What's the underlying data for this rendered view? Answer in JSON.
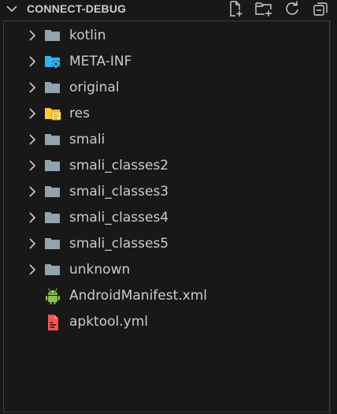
{
  "explorer": {
    "title": "CONNECT-DEBUG",
    "actions": [
      {
        "name": "new-file-icon"
      },
      {
        "name": "new-folder-icon"
      },
      {
        "name": "refresh-icon"
      },
      {
        "name": "collapse-all-icon"
      }
    ],
    "items": [
      {
        "label": "kotlin",
        "type": "folder",
        "icon": "folder-icon"
      },
      {
        "label": "META-INF",
        "type": "folder",
        "icon": "folder-config-icon"
      },
      {
        "label": "original",
        "type": "folder",
        "icon": "folder-icon"
      },
      {
        "label": "res",
        "type": "folder",
        "icon": "folder-resource-icon"
      },
      {
        "label": "smali",
        "type": "folder",
        "icon": "folder-icon"
      },
      {
        "label": "smali_classes2",
        "type": "folder",
        "icon": "folder-icon"
      },
      {
        "label": "smali_classes3",
        "type": "folder",
        "icon": "folder-icon"
      },
      {
        "label": "smali_classes4",
        "type": "folder",
        "icon": "folder-icon"
      },
      {
        "label": "smali_classes5",
        "type": "folder",
        "icon": "folder-icon"
      },
      {
        "label": "unknown",
        "type": "folder",
        "icon": "folder-icon"
      },
      {
        "label": "AndroidManifest.xml",
        "type": "file",
        "icon": "android-icon"
      },
      {
        "label": "apktool.yml",
        "type": "file",
        "icon": "yaml-file-icon"
      }
    ]
  },
  "colors": {
    "background": "#181818",
    "text": "#cccccc",
    "folder": "#90a4ae",
    "folder_config": "#29b6f6",
    "folder_resource": "#ffca28",
    "android": "#8bc34a",
    "yaml": "#ff5252"
  }
}
